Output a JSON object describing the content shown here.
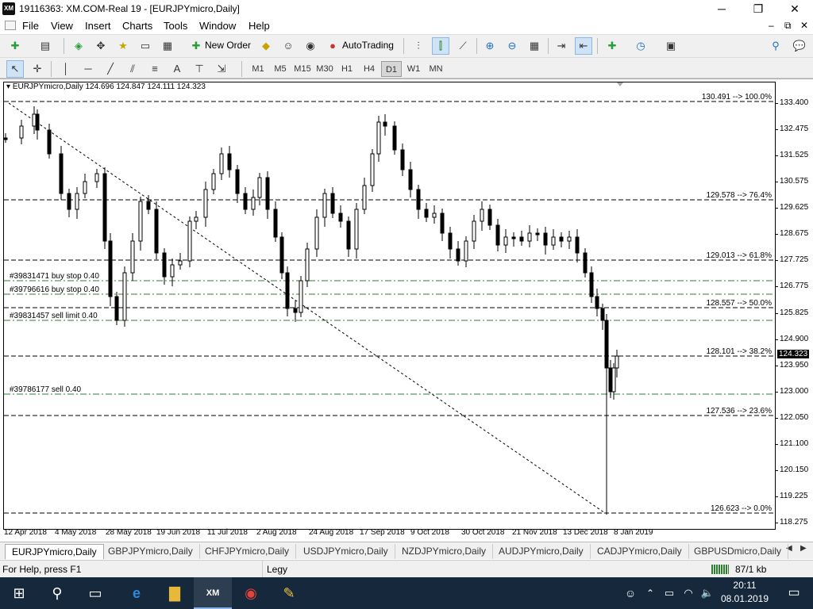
{
  "window": {
    "title": "19116363: XM.COM-Real 19 - [EURJPYmicro,Daily]",
    "logo_text": "XM",
    "min": "─",
    "max": "❐",
    "close": "✕",
    "sub_min": "–",
    "sub_restore": "⧉",
    "sub_close": "✕"
  },
  "menu": [
    "File",
    "View",
    "Insert",
    "Charts",
    "Tools",
    "Window",
    "Help"
  ],
  "toolbar": {
    "new_order": "New Order",
    "autotrading": "AutoTrading"
  },
  "timeframes": [
    "M1",
    "M5",
    "M15",
    "M30",
    "H1",
    "H4",
    "D1",
    "W1",
    "MN"
  ],
  "active_timeframe": "D1",
  "chart": {
    "header": "EURJPYmicro,Daily  124.696 124.847 124.111 124.323",
    "current_price": "124.323",
    "y_ticks": [
      "133.400",
      "132.475",
      "131.525",
      "130.575",
      "129.625",
      "128.675",
      "127.725",
      "126.775",
      "125.825",
      "124.900",
      "123.950",
      "123.000",
      "122.050",
      "121.100",
      "120.150",
      "119.225",
      "118.275"
    ],
    "x_ticks": [
      "12 Apr 2018",
      "4 May 2018",
      "28 May 2018",
      "19 Jun 2018",
      "11 Jul 2018",
      "2 Aug 2018",
      "24 Aug 2018",
      "17 Sep 2018",
      "9 Oct 2018",
      "30 Oct 2018",
      "21 Nov 2018",
      "13 Dec 2018",
      "8 Jan 2019"
    ],
    "fib_levels": [
      {
        "label": "130.491 --> 100.0%",
        "price": 130.491
      },
      {
        "label": "129.578 --> 76.4%",
        "price": 129.578
      },
      {
        "label": "129.013 --> 61.8%",
        "price": 129.013
      },
      {
        "label": "128.557 --> 50.0%",
        "price": 128.557
      },
      {
        "label": "128.101 --> 38.2%",
        "price": 128.101
      },
      {
        "label": "127.536 --> 23.6%",
        "price": 127.536
      },
      {
        "label": "126.623 --> 0.0%",
        "price": 126.623
      }
    ],
    "orders": [
      {
        "label": "#39831471 buy stop 0.40"
      },
      {
        "label": "#39796616 buy stop 0.40"
      },
      {
        "label": "#39831457 sell limit 0.40"
      },
      {
        "label": "#39786177 sell 0.40"
      }
    ]
  },
  "tabs": [
    "EURJPYmicro,Daily",
    "GBPJPYmicro,Daily",
    "CHFJPYmicro,Daily",
    "USDJPYmicro,Daily",
    "NZDJPYmicro,Daily",
    "AUDJPYmicro,Daily",
    "CADJPYmicro,Daily",
    "GBPUSDmicro,Daily"
  ],
  "status": {
    "help": "For Help, press F1",
    "profile": "Legy",
    "traffic": "87/1 kb"
  },
  "taskbar": {
    "time": "20:11",
    "date": "08.01.2019"
  },
  "colors": {
    "chart_bg": "#ffffff",
    "candle": "#000000",
    "order_line": "#2e7d32",
    "taskbar": "#16283b"
  }
}
